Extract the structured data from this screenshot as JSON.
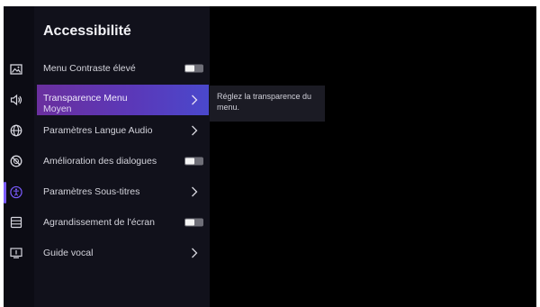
{
  "screen": {
    "title": "Accessibilité"
  },
  "sidebar": {
    "icons": [
      {
        "name": "picture-icon",
        "active": false
      },
      {
        "name": "speaker-icon",
        "active": false
      },
      {
        "name": "globe-icon",
        "active": false
      },
      {
        "name": "no-disturb-icon",
        "active": false
      },
      {
        "name": "accessibility-icon",
        "active": true
      },
      {
        "name": "list-icon",
        "active": false
      },
      {
        "name": "tv-info-icon",
        "active": false
      }
    ]
  },
  "menu": {
    "items": [
      {
        "label": "Menu Contraste élevé",
        "control": "toggle",
        "value": "off"
      },
      {
        "label": "Transparence Menu",
        "sublabel": "Moyen",
        "control": "chevron",
        "selected": true
      },
      {
        "label": "Paramètres Langue Audio",
        "control": "chevron"
      },
      {
        "label": "Amélioration des dialogues",
        "control": "toggle",
        "value": "off"
      },
      {
        "label": "Paramètres Sous-titres",
        "control": "chevron"
      },
      {
        "label": "Agrandissement de l'écran",
        "control": "toggle",
        "value": "off"
      },
      {
        "label": "Guide vocal",
        "control": "chevron"
      }
    ]
  },
  "tooltip": {
    "text": "Réglez la transparence du menu."
  },
  "colors": {
    "accent_start": "#6a2f9e",
    "accent_end": "#4a48cc",
    "active_icon": "#7b5cff"
  }
}
